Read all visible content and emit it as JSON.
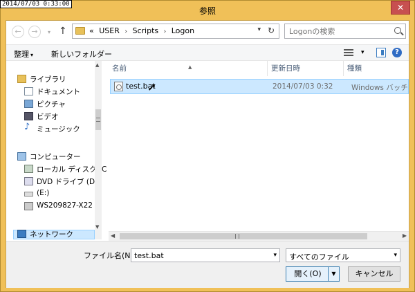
{
  "overlay": {
    "timestamp": "2014/07/03 0:33:00"
  },
  "window": {
    "title": "参照",
    "close_glyph": "✕"
  },
  "address": {
    "back_glyph": "←",
    "forward_glyph": "→",
    "dropdown_glyph": "▾",
    "up_glyph": "↑",
    "overflow": "«",
    "crumbs": [
      "USER",
      "Scripts",
      "Logon"
    ],
    "separator": "›",
    "refresh_glyph": "↻"
  },
  "search": {
    "placeholder": "Logonの検索"
  },
  "toolbar": {
    "organize": "整理",
    "organize_caret": "▾",
    "new_folder": "新しいフォルダー",
    "view_dd": "▾",
    "help": "?"
  },
  "nav": {
    "items": [
      {
        "label": "ライブラリ",
        "icon": "libraries-icon"
      },
      {
        "label": "ドキュメント",
        "icon": "documents-icon"
      },
      {
        "label": "ピクチャ",
        "icon": "pictures-icon"
      },
      {
        "label": "ビデオ",
        "icon": "videos-icon"
      },
      {
        "label": "ミュージック",
        "icon": "music-icon"
      },
      {
        "label": "コンピューター",
        "icon": "computer-icon"
      },
      {
        "label": "ローカル ディスク (C",
        "icon": "local-disk-icon"
      },
      {
        "label": "DVD ドライブ (D:)",
        "icon": "dvd-drive-icon"
      },
      {
        "label": " (E:)",
        "icon": "drive-e-icon"
      },
      {
        "label": "WS209827-X22",
        "icon": "network-share-icon"
      },
      {
        "label": "ネットワーク",
        "icon": "network-icon"
      }
    ],
    "scroll_up": "▲",
    "scroll_down": "▼"
  },
  "files": {
    "columns": [
      "名前",
      "更新日時",
      "種類"
    ],
    "sort_glyph": "▲",
    "rows": [
      {
        "name": "test.bat",
        "date": "2014/07/03 0:32",
        "type": "Windows バッチ フ..."
      }
    ]
  },
  "hscroll": {
    "left": "◀",
    "right": "▶"
  },
  "bottom": {
    "filename_label": "ファイル名(N):",
    "filename_value": "test.bat",
    "filter_value": "すべてのファイル",
    "dd_glyph": "▾",
    "open_label": "開く(O)",
    "open_split": "▼",
    "cancel_label": "キャンセル"
  },
  "colors": {
    "title_bar": "#f0c058",
    "selection": "#cce8ff",
    "accent": "#3c7fb1"
  }
}
